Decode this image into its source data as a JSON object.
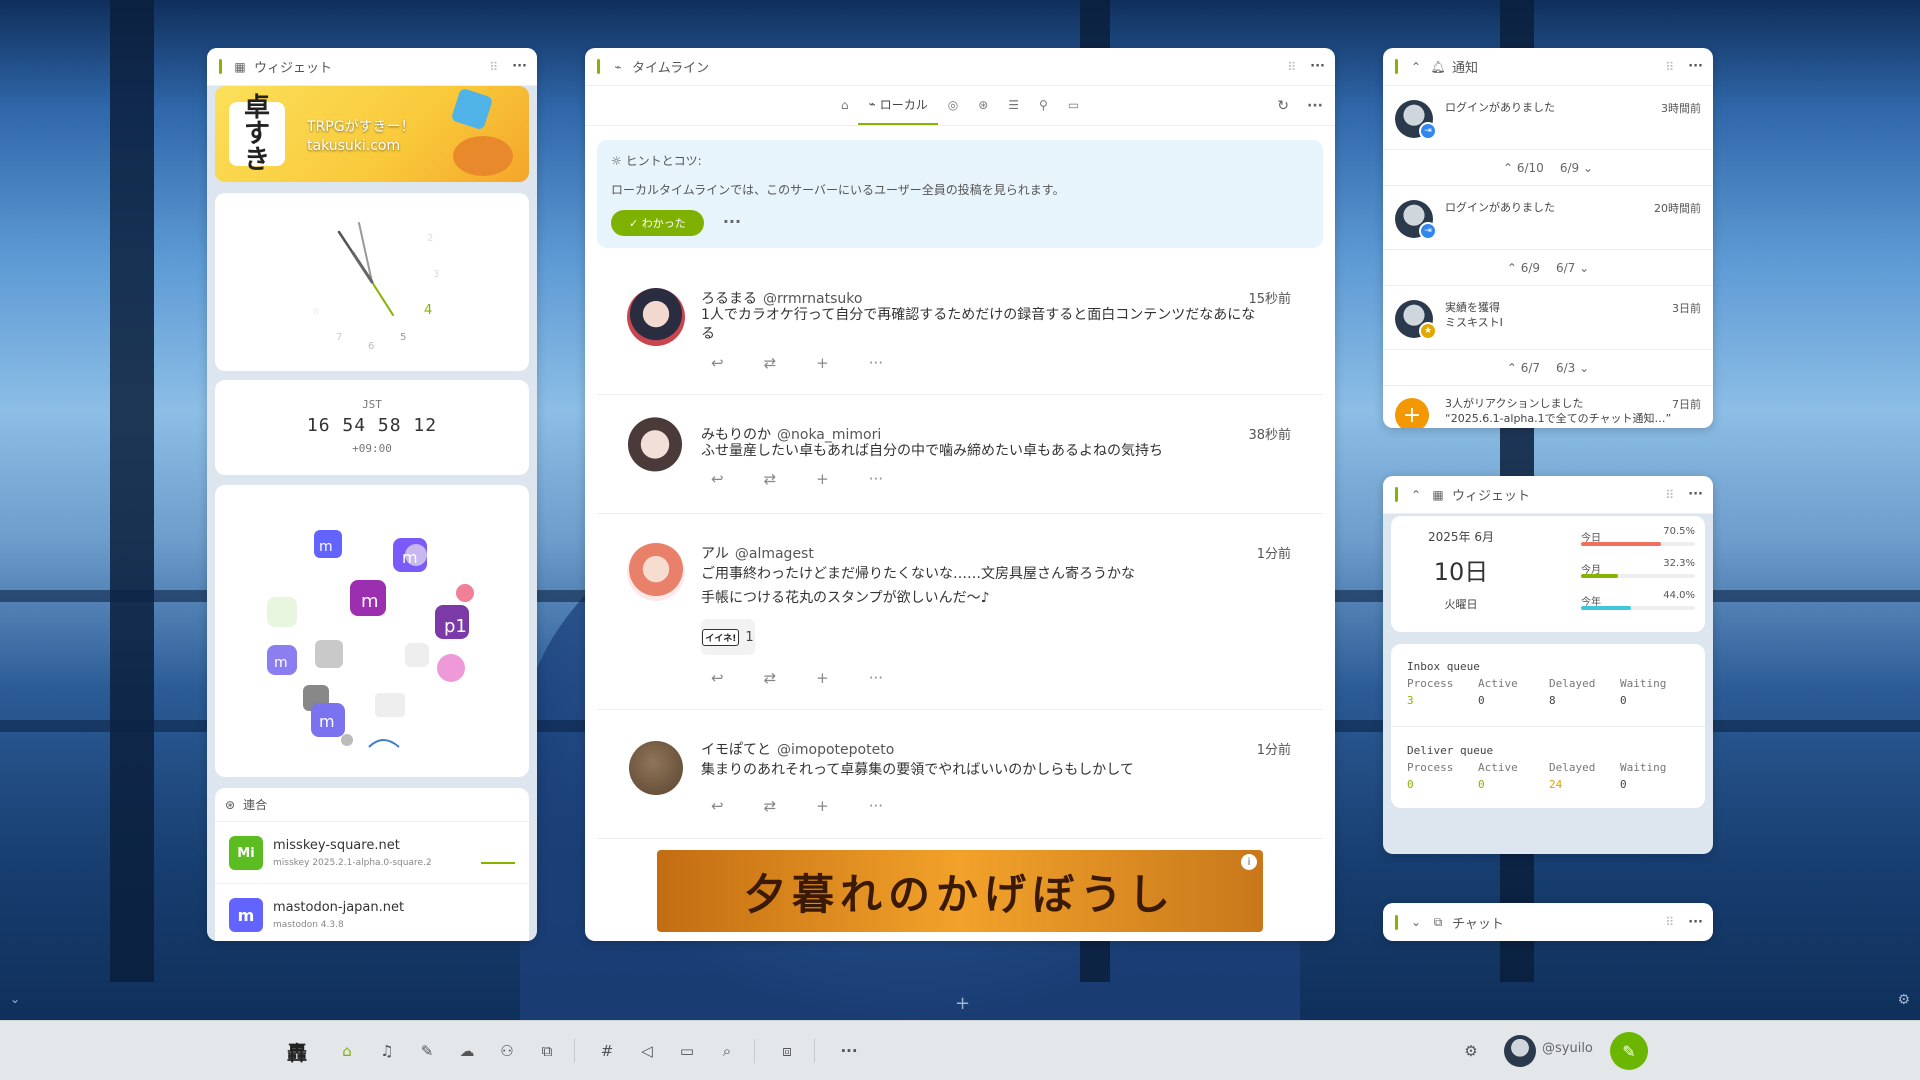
{
  "widgets_left": {
    "title": "ウィジェット",
    "banner_text": "TRPGがすきー！",
    "banner_url": "takusuki.com",
    "banner_logo": "卓すき",
    "clock_digital": {
      "zone": "JST",
      "time": "16 54 58 12",
      "offset": "+09:00"
    },
    "federation": {
      "title": "連合",
      "items": [
        {
          "host": "misskey-square.net",
          "software": "misskey 2025.2.1-alpha.0-square.2",
          "icon": "Mi"
        },
        {
          "host": "mastodon-japan.net",
          "software": "mastodon 4.3.8",
          "icon": "m"
        }
      ]
    }
  },
  "timeline": {
    "title": "タイムライン",
    "tabs": [
      "ローカル"
    ],
    "hint": {
      "title": "ヒントとコツ:",
      "body": "ローカルタイムラインでは、このサーバーにいるユーザー全員の投稿を見られます。",
      "button": "わかった"
    },
    "notes": [
      {
        "name": "ろるまる",
        "acct": "@rrmrnatsuko",
        "time": "15秒前",
        "text": "1人でカラオケ行って自分で再確認するためだけの録音すると面白コンテンツだなあにな\nる"
      },
      {
        "name": "みもりのか",
        "acct": "@noka_mimori",
        "time": "38秒前",
        "text": "ふせ量産したい卓もあれば自分の中で噛み締めたい卓もあるよねの気持ち"
      },
      {
        "name": "アル",
        "acct": "@almagest",
        "time": "1分前",
        "text": "ご用事終わったけどまだ帰りたくないな……文房具屋さん寄ろうかな",
        "text2": "手帳につける花丸のスタンプが欲しいんだ〜♪",
        "reaction": "イイネ!",
        "reaction_count": "1"
      },
      {
        "name": "イモぽてと",
        "acct": "@imopotepoteto",
        "time": "1分前",
        "text": "集まりのあれそれって卓募集の要領でやればいいのかしらもしかして"
      }
    ],
    "banner": "夕暮れのかげぼうし"
  },
  "notifications": {
    "title": "通知",
    "items": [
      {
        "text": "ログインがありました",
        "time": "3時間前",
        "badge": "login"
      },
      {
        "text": "ログインがありました",
        "time": "20時間前",
        "badge": "login"
      },
      {
        "text": "実績を獲得",
        "text2": "ミスキストⅠ",
        "time": "3日前",
        "badge": "achievement"
      },
      {
        "text": "3人がリアクションしました",
        "text2": "“2025.6.1-alpha.1で全てのチャット通知…”",
        "time": "7日前",
        "badge": "reaction"
      }
    ],
    "pagers": [
      {
        "prev": "6/10",
        "next": "6/9"
      },
      {
        "prev": "6/9",
        "next": "6/7"
      },
      {
        "prev": "6/7",
        "next": "6/3"
      }
    ]
  },
  "widgets_right": {
    "title": "ウィジェット",
    "calendar": {
      "year_month": "2025年 6月",
      "day": "10日",
      "weekday": "火曜日",
      "bars": [
        {
          "label": "今日",
          "value": "70.5%",
          "fraction": 0.705,
          "color": "#f07060"
        },
        {
          "label": "今月",
          "value": "32.3%",
          "fraction": 0.323,
          "color": "#86b300"
        },
        {
          "label": "今年",
          "value": "44.0%",
          "fraction": 0.44,
          "color": "#3fc6d8"
        }
      ]
    },
    "queues": [
      {
        "title": "Inbox queue",
        "headers": [
          "Process",
          "Active",
          "Delayed",
          "Waiting"
        ],
        "values": [
          "3",
          "0",
          "8",
          "0"
        ]
      },
      {
        "title": "Deliver queue",
        "headers": [
          "Process",
          "Active",
          "Delayed",
          "Waiting"
        ],
        "values": [
          "0",
          "0",
          "24",
          "0"
        ]
      }
    ]
  },
  "chat": {
    "title": "チャット"
  },
  "account": {
    "username": "@syuilo"
  },
  "colors": {
    "accent": "#86b300",
    "orange": "#f39800",
    "blue": "#2f87f0"
  }
}
